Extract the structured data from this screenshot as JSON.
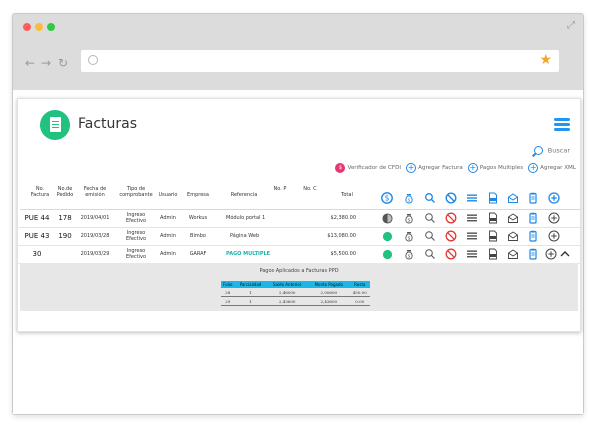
{
  "app": {
    "title": "Facturas",
    "search_label": "Buscar",
    "actions": [
      {
        "label": "Verificador de CFDI",
        "icon": "dollar-badge-icon"
      },
      {
        "label": "Agregar Factura",
        "icon": "plus-circle-icon"
      },
      {
        "label": "Pagos Multiples",
        "icon": "plus-circle-icon"
      },
      {
        "label": "Agregar XML",
        "icon": "plus-circle-icon"
      }
    ]
  },
  "table": {
    "headers": {
      "no_factura": "No. Factura",
      "no_pedido": "No.de Pedido",
      "fecha": "Fecha de emisión",
      "tipo": "Tipo de comprobante",
      "usuario": "Usuario",
      "empresa": "Empresa",
      "referencia": "Referencia",
      "no_p": "No. P",
      "no_c": "No. C",
      "total": "Total"
    },
    "rows": [
      {
        "no_factura": "PUE 44",
        "no_pedido": "178",
        "fecha": "2019/04/01",
        "tipo": "Ingreso Efectivo",
        "usuario": "Admin",
        "empresa": "Workus",
        "referencia": "Módulo portal 1",
        "total": "$2,380.00",
        "status": "partial"
      },
      {
        "no_factura": "PUE 43",
        "no_pedido": "190",
        "fecha": "2019/03/28",
        "tipo": "Ingreso Efectivo",
        "usuario": "Admin",
        "empresa": "Bimbo",
        "referencia": "Página Web",
        "total": "$13,080.00",
        "status": "paid"
      },
      {
        "no_factura": "30",
        "no_pedido": "",
        "fecha": "2019/03/29",
        "tipo": "Ingreso Efectivo",
        "usuario": "Admin",
        "empresa": "GARAF",
        "referencia": "PAGO MULTIPLE",
        "total": "$5,500.00",
        "status": "paid"
      }
    ]
  },
  "payments": {
    "title": "Pagos Aplicados a Facturas PPD",
    "headers": [
      "Folio",
      "Parcialidad",
      "Saldo Anterior",
      "Monto Pagado",
      "Resta"
    ],
    "rows": [
      [
        "28",
        "1",
        "2,48000",
        "2,00600",
        "450.00"
      ],
      [
        "29",
        "1",
        "2,43600",
        "2,43600",
        "0.00"
      ]
    ]
  },
  "colors": {
    "brand_green": "#21c17f",
    "accent_blue": "#1e88e5",
    "status_green": "#21c17f",
    "danger_red": "#e53935",
    "link_teal": "#1ab2a8",
    "subtable_header": "#1ab7e8"
  }
}
